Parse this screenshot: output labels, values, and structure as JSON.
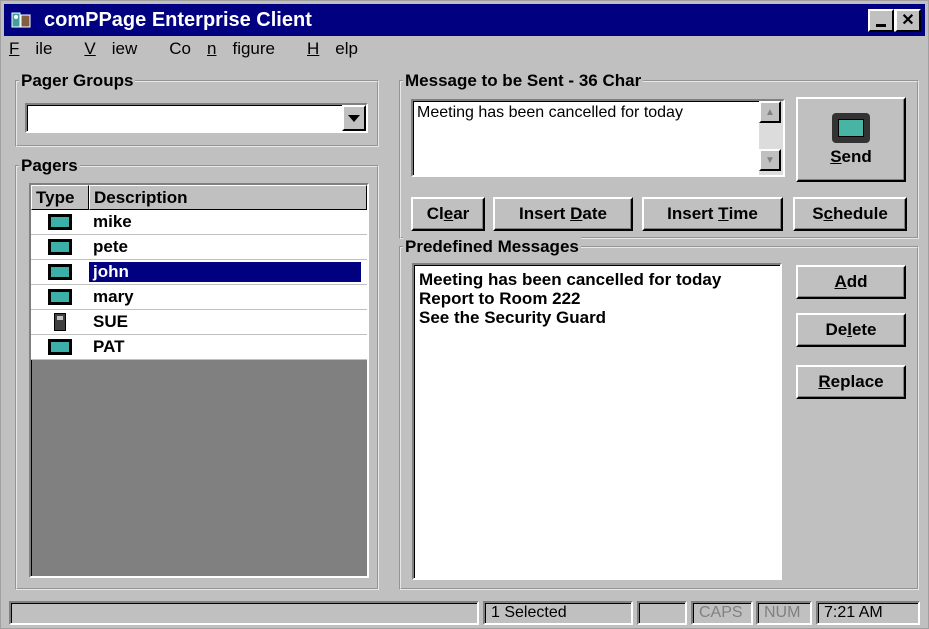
{
  "window": {
    "title": "comPPage Enterprise Client"
  },
  "menu": [
    {
      "label": "File",
      "mn": "F",
      "rest": "ile"
    },
    {
      "label": "View",
      "mn": "V",
      "rest": "iew"
    },
    {
      "label": "Configure",
      "pre": "Co",
      "mn": "n",
      "rest": "figure"
    },
    {
      "label": "Help",
      "mn": "H",
      "rest": "elp"
    }
  ],
  "pager_groups": {
    "label": "Pager Groups",
    "selected_value": ""
  },
  "pagers": {
    "label": "Pagers",
    "columns": [
      "Type",
      "Description"
    ],
    "rows": [
      {
        "type_icon": "alphanumeric-pager-icon",
        "description": "mike"
      },
      {
        "type_icon": "alphanumeric-pager-icon",
        "description": "pete"
      },
      {
        "type_icon": "alphanumeric-pager-icon",
        "description": "john",
        "selected": true
      },
      {
        "type_icon": "alphanumeric-pager-icon",
        "description": "mary"
      },
      {
        "type_icon": "numeric-pager-icon",
        "description": "SUE"
      },
      {
        "type_icon": "alphanumeric-pager-icon",
        "description": "PAT"
      }
    ]
  },
  "message": {
    "label": "Message to be Sent - 36 Char",
    "value": "Meeting has been cancelled for today"
  },
  "buttons": {
    "send": {
      "mn": "S",
      "rest": "end"
    },
    "clear": {
      "pre": "Cl",
      "mn": "e",
      "rest": "ar"
    },
    "insert_date": {
      "pre": "Insert ",
      "mn": "D",
      "rest": "ate"
    },
    "insert_time": {
      "pre": "Insert ",
      "mn": "T",
      "rest": "ime"
    },
    "schedule": {
      "pre": "S",
      "mn": "c",
      "rest": "hedule"
    },
    "add": {
      "mn": "A",
      "rest": "dd"
    },
    "delete": {
      "pre": "De",
      "mn": "l",
      "rest": "ete"
    },
    "replace": {
      "mn": "R",
      "rest": "eplace"
    }
  },
  "predefined": {
    "label": "Predefined Messages",
    "items": [
      "Meeting has been cancelled for today",
      "Report to Room 222",
      "See the Security Guard"
    ]
  },
  "statusbar": {
    "selected": "1 Selected",
    "caps": "CAPS",
    "num": "NUM",
    "time": "7:21 AM"
  },
  "colors": {
    "title_bar": "#000080",
    "face": "#c0c0c0",
    "selection": "#000080"
  }
}
